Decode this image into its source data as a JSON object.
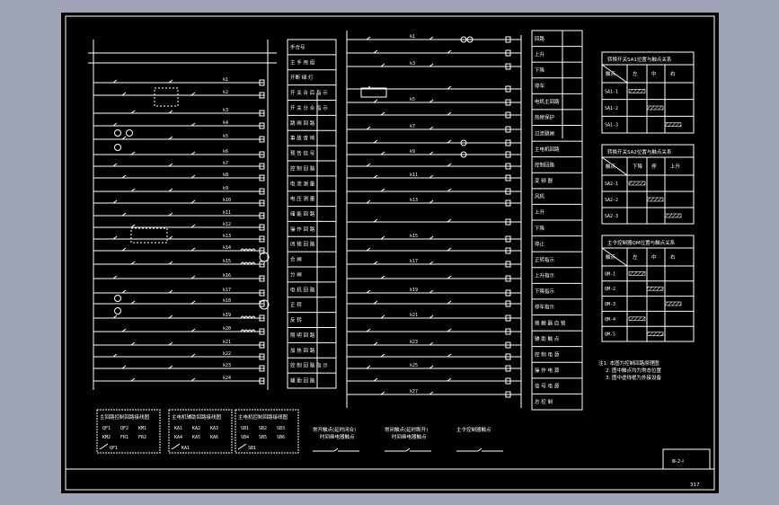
{
  "drawing": {
    "number": "Ⅲ-2-Ⅰ",
    "page": "317"
  },
  "function_labels": [
    "手合号",
    "主 手 用 组",
    "开断 绿 灯",
    "开 关 合 后 指 示",
    "开 关 分 合 指 示",
    "跳 闸 回 路",
    "事 故 音 响",
    "预 告 信 号",
    "控 制 回 路",
    "电 流 测 量",
    "电 压 测 量",
    "储 能 回 路",
    "操 作 回 路",
    "闭 锁 回 路",
    "合 闸",
    "分 闸",
    "电 机 回 路",
    "正 转",
    "反 转",
    "照 明 回 路",
    "加 热 回 路",
    "控 制 回 路 指 示",
    "辅 助 回 路"
  ],
  "right_labels": [
    "回路",
    "上升",
    "下降",
    "停车",
    "电机主回路",
    "热继保护",
    "过流跳闸",
    "主电机回路",
    "控制回路",
    "变 频 器",
    "风机",
    "上升",
    "下降",
    "停止",
    "正转指示",
    "上升指示",
    "下降指示",
    "停车指示",
    "接 触 器 自 锁",
    "辅 助 触 点",
    "控 制 电 源",
    "操 作 电 源",
    "信 号 电 源",
    "总 控 制"
  ],
  "tables": [
    {
      "title": "转换开关SA1位置与触点关系",
      "headers": [
        "触点",
        "左",
        "中",
        "右"
      ],
      "rows": [
        "SA1-1",
        "SA1-2",
        "SA1-3"
      ]
    },
    {
      "title": "转换开关SA2位置与触点关系",
      "headers": [
        "触点",
        "下降",
        "停",
        "上升"
      ],
      "rows": [
        "SA2-1",
        "SA2-2",
        "SA2-3"
      ]
    },
    {
      "title": "主令控制器QM位置与触点关系",
      "headers": [
        "触点",
        "左",
        "中",
        "右"
      ],
      "rows": [
        "QM-1",
        "QM-2",
        "QM-3",
        "QM-4",
        "QM-5"
      ]
    }
  ],
  "notes": [
    "注1: 本图为控制回路原理图",
    "2. 图中触点均为常态位置",
    "3. 图中虚线框为外接设备"
  ],
  "legends": [
    {
      "title": "主回路控制回路接线图",
      "items": [
        "QF1",
        "QF2",
        "KM1",
        "KM2",
        "FR1",
        "FR2"
      ],
      "tag": "QF1"
    },
    {
      "title": "主电机辅助回路接线图",
      "items": [
        "KA1",
        "KA2",
        "KA3",
        "KA4",
        "KA5",
        "KA6"
      ],
      "tag": "KA1"
    },
    {
      "title": "主电机控制回路接线图",
      "items": [
        "SB1",
        "SB2",
        "SB3",
        "SB4",
        "SB5",
        "SB6"
      ],
      "tag": "SB1"
    }
  ],
  "symbol_notes": [
    {
      "title": "常开触点(延时闭合)",
      "sub": "时间继电器触点"
    },
    {
      "title": "常闭触点(延时断开)",
      "sub": "时间继电器触点"
    },
    {
      "title": "主令控制器触点"
    }
  ]
}
